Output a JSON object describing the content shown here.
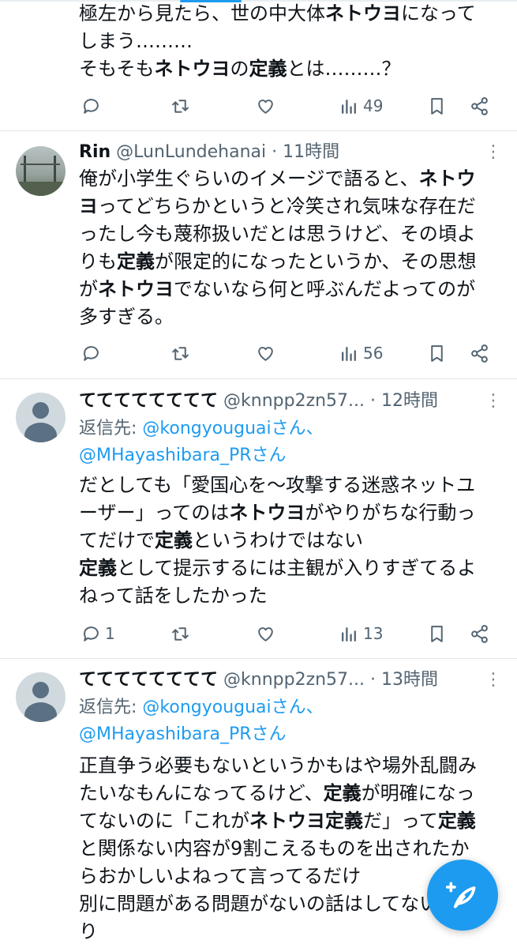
{
  "tweet0": {
    "lines": [
      [
        {
          "t": "極左から見たら、世の中大体"
        },
        {
          "t": "ネトウヨ",
          "b": true
        },
        {
          "t": "になって"
        }
      ],
      [
        {
          "t": "しまう………"
        }
      ],
      [
        {
          "t": "そもそも"
        },
        {
          "t": "ネトウヨ",
          "b": true
        },
        {
          "t": "の"
        },
        {
          "t": "定義",
          "b": true
        },
        {
          "t": "とは………？"
        }
      ]
    ],
    "replies": "",
    "retweets": "",
    "likes": "",
    "views": "49"
  },
  "tweet1": {
    "name": "Rin",
    "handle": "@LunLundehanai",
    "sep": "·",
    "time": "11時間",
    "lines": [
      [
        {
          "t": "俺が小学生ぐらいのイメージで語ると、"
        },
        {
          "t": "ネトウ",
          "b": true
        }
      ],
      [
        {
          "t": "ヨ",
          "b": true
        },
        {
          "t": "ってどちらかというと冷笑され気味な存在だ"
        }
      ],
      [
        {
          "t": "ったし今も蔑称扱いだとは思うけど、その頃よ"
        }
      ],
      [
        {
          "t": "りも"
        },
        {
          "t": "定義",
          "b": true
        },
        {
          "t": "が限定的になったというか、その思想"
        }
      ],
      [
        {
          "t": "が"
        },
        {
          "t": "ネトウヨ",
          "b": true
        },
        {
          "t": "でないなら何と呼ぶんだよってのが"
        }
      ],
      [
        {
          "t": "多すぎる。"
        }
      ]
    ],
    "replies": "",
    "retweets": "",
    "likes": "",
    "views": "56"
  },
  "tweet2": {
    "name": "てててててててて",
    "handle": "@knnpp2zn57...",
    "sep": "·",
    "time": "12時間",
    "reply_prefix": "返信先: ",
    "mention1": "@kongyouguaiさん、",
    "mention2": "@MHayashibara_PRさん",
    "lines": [
      [
        {
          "t": "だとしても「愛国心を〜攻撃する迷惑ネットユ"
        }
      ],
      [
        {
          "t": "ーザー」ってのは"
        },
        {
          "t": "ネトウヨ",
          "b": true
        },
        {
          "t": "がやりがちな行動っ"
        }
      ],
      [
        {
          "t": "てだけで"
        },
        {
          "t": "定義",
          "b": true
        },
        {
          "t": "というわけではない"
        }
      ],
      [
        {
          "t": "定義",
          "b": true
        },
        {
          "t": "として提示するには主観が入りすぎてるよ"
        }
      ],
      [
        {
          "t": "ねって話をしたかった"
        }
      ]
    ],
    "replies": "1",
    "retweets": "",
    "likes": "",
    "views": "13"
  },
  "tweet3": {
    "name": "てててててててて",
    "handle": "@knnpp2zn57...",
    "sep": "·",
    "time": "13時間",
    "reply_prefix": "返信先: ",
    "mention1": "@kongyouguaiさん、",
    "mention2": "@MHayashibara_PRさん",
    "lines": [
      [
        {
          "t": "正直争う必要もないというかもはや場外乱闘み"
        }
      ],
      [
        {
          "t": "たいなもんになってるけど、"
        },
        {
          "t": "定義",
          "b": true
        },
        {
          "t": "が明確になっ"
        }
      ],
      [
        {
          "t": "てないのに「これが"
        },
        {
          "t": "ネトウヨ定義",
          "b": true
        },
        {
          "t": "だ」って"
        },
        {
          "t": "定義",
          "b": true
        }
      ],
      [
        {
          "t": "と関係ない内容が9割こえるものを出されたか"
        }
      ],
      [
        {
          "t": "らおかしいよねって言ってるだけ"
        }
      ],
      [
        {
          "t": "別に問題がある問題がないの話はしてないつも"
        }
      ],
      [
        {
          "t": "り"
        }
      ]
    ]
  },
  "colors": {
    "accent": "#1d9bf0",
    "text": "#0f1419",
    "muted": "#536471",
    "divider": "#dfe6ea"
  },
  "icons": {
    "reply": "reply-icon",
    "retweet": "retweet-icon",
    "like": "heart-icon",
    "views": "views-icon",
    "bookmark": "bookmark-icon",
    "share": "share-icon",
    "compose": "compose-icon"
  }
}
